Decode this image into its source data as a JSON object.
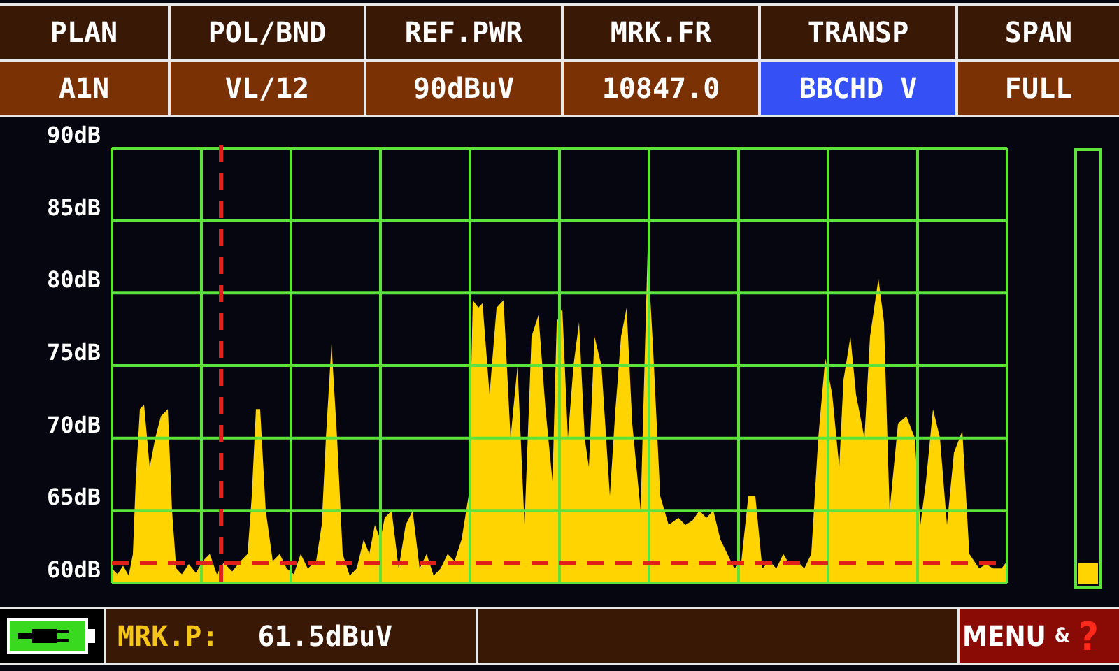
{
  "header": [
    {
      "label": "PLAN",
      "value": "A1N",
      "selected": false
    },
    {
      "label": "POL/BND",
      "value": "VL/12",
      "selected": false
    },
    {
      "label": "REF.PWR",
      "value": "90dBuV",
      "selected": false
    },
    {
      "label": "MRK.FR",
      "value": "10847.0",
      "selected": false
    },
    {
      "label": "TRANSP",
      "value": "BBCHD V",
      "selected": true
    },
    {
      "label": "SPAN",
      "value": "FULL",
      "selected": false
    }
  ],
  "spectrum": {
    "y_labels": [
      "90dB",
      "85dB",
      "80dB",
      "75dB",
      "70dB",
      "65dB",
      "60dB"
    ]
  },
  "level_meter": {
    "level": 0.05
  },
  "status_bar": {
    "marker_label": "MRK.P:",
    "marker_value": "61.5dBuV",
    "menu": {
      "label": "MENU",
      "joiner": "&",
      "help": "?"
    }
  }
}
